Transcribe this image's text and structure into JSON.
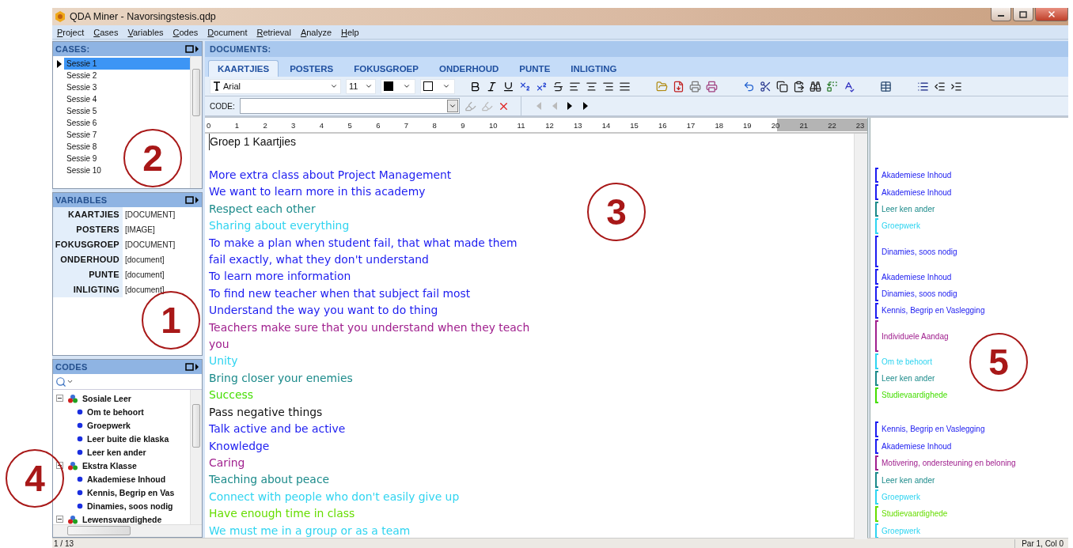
{
  "window": {
    "title": "QDA Miner - Navorsingstesis.qdp"
  },
  "menu": [
    "Project",
    "Cases",
    "Variables",
    "Codes",
    "Document",
    "Retrieval",
    "Analyze",
    "Help"
  ],
  "cases": {
    "title": "CASES:",
    "items": [
      {
        "label": "Sessie 1",
        "selected": true
      },
      {
        "label": "Sessie 2",
        "selected": false
      },
      {
        "label": "Sessie 3",
        "selected": false
      },
      {
        "label": "Sessie 4",
        "selected": false
      },
      {
        "label": "Sessie 5",
        "selected": false
      },
      {
        "label": "Sessie 6",
        "selected": false
      },
      {
        "label": "Sessie 7",
        "selected": false
      },
      {
        "label": "Sessie 8",
        "selected": false
      },
      {
        "label": "Sessie 9",
        "selected": false
      },
      {
        "label": "Sessie 10",
        "selected": false
      }
    ]
  },
  "variables": {
    "title": "VARIABLES",
    "items": [
      {
        "name": "KAARTJIES",
        "type": "[DOCUMENT]"
      },
      {
        "name": "POSTERS",
        "type": "[IMAGE]"
      },
      {
        "name": "FOKUSGROEP",
        "type": "[DOCUMENT]"
      },
      {
        "name": "ONDERHOUD",
        "type": "[document]"
      },
      {
        "name": "PUNTE",
        "type": "[document]"
      },
      {
        "name": "INLIGTING",
        "type": "[document]"
      }
    ]
  },
  "codes": {
    "title": "CODES",
    "tree": [
      {
        "label": "Sosiale Leer",
        "expanded": true,
        "children": [
          {
            "label": "Om te behoort"
          },
          {
            "label": "Groepwerk"
          },
          {
            "label": "Leer buite die klaska"
          },
          {
            "label": "Leer ken ander"
          }
        ]
      },
      {
        "label": "Ekstra Klasse",
        "expanded": true,
        "children": [
          {
            "label": "Akademiese Inhoud"
          },
          {
            "label": "Kennis, Begrip en Vas"
          },
          {
            "label": "Dinamies, soos nodig"
          }
        ]
      },
      {
        "label": "Lewensvaardighede",
        "expanded": true
      }
    ]
  },
  "documents": {
    "title": "DOCUMENTS:",
    "tabs": [
      {
        "label": "KAARTJIES",
        "selected": true
      },
      {
        "label": "POSTERS",
        "selected": false
      },
      {
        "label": "FOKUSGROEP",
        "selected": false
      },
      {
        "label": "ONDERHOUD",
        "selected": false
      },
      {
        "label": "PUNTE",
        "selected": false
      },
      {
        "label": "INLIGTING",
        "selected": false
      }
    ],
    "font": "Arial",
    "font_size": "11",
    "code_label": "CODE:",
    "ruler": [
      "0",
      "1",
      "2",
      "3",
      "4",
      "5",
      "6",
      "7",
      "8",
      "9",
      "10",
      "11",
      "12",
      "13",
      "14",
      "15",
      "16",
      "17",
      "18",
      "19",
      "20",
      "21",
      "22",
      "23"
    ],
    "heading": "Groep 1 Kaartjies",
    "paragraphs": [
      {
        "text": "More extra class about Project Management",
        "color": "#1c1cf0",
        "code": {
          "label": "Akademiese Inhoud",
          "color": "#1c1cf0"
        }
      },
      {
        "text": "We want to learn more in this academy",
        "color": "#1c1cf0",
        "code": {
          "label": "Akademiese Inhoud",
          "color": "#1c1cf0"
        }
      },
      {
        "text": "Respect each other",
        "color": "#1b8a8a",
        "code": {
          "label": "Leer ken ander",
          "color": "#1b8a8a"
        }
      },
      {
        "text": "Sharing about everything",
        "color": "#2fd4f0",
        "code": {
          "label": "Groepwerk",
          "color": "#2fd4f0"
        }
      },
      {
        "text": "To make a plan when student fail, that what made them fail exactly, what they don't understand",
        "color": "#1c1cf0",
        "code": {
          "label": "Dinamies, soos nodig",
          "color": "#1c1cf0"
        }
      },
      {
        "text": "To learn more information",
        "color": "#1c1cf0",
        "code": {
          "label": "Akademiese Inhoud",
          "color": "#1c1cf0"
        }
      },
      {
        "text": "To find new teacher when that subject fail most",
        "color": "#1c1cf0",
        "code": {
          "label": "Dinamies, soos nodig",
          "color": "#1c1cf0"
        }
      },
      {
        "text": "Understand the way you want to do thing",
        "color": "#1c1cf0",
        "code": {
          "label": "Kennis, Begrip en Vaslegging",
          "color": "#1c1cf0"
        }
      },
      {
        "text": "Teachers make sure that you understand when they teach you",
        "color": "#a0208e",
        "code": {
          "label": "Individuele Aandag",
          "color": "#a0208e"
        }
      },
      {
        "text": "Unity",
        "color": "#2fd4f0",
        "code": {
          "label": "Om te behoort",
          "color": "#2fd4f0"
        }
      },
      {
        "text": "Bring closer your enemies",
        "color": "#1b8a8a",
        "code": {
          "label": "Leer ken ander",
          "color": "#1b8a8a"
        }
      },
      {
        "text": "Success",
        "color": "#44dd00",
        "code": {
          "label": "Studievaardighede",
          "color": "#44dd00"
        }
      },
      {
        "text": "Pass negative things",
        "color": "#111111"
      },
      {
        "text": "Talk active and be active",
        "color": "#1c1cf0",
        "code": {
          "label": "Kennis, Begrip en Vaslegging",
          "color": "#1c1cf0"
        }
      },
      {
        "text": "Knowledge",
        "color": "#1c1cf0",
        "code": {
          "label": "Akademiese Inhoud",
          "color": "#1c1cf0"
        }
      },
      {
        "text": "Caring",
        "color": "#a0208e",
        "code": {
          "label": "Motivering, ondersteuning en beloning",
          "color": "#a0208e"
        }
      },
      {
        "text": "Teaching about peace",
        "color": "#1b8a8a",
        "code": {
          "label": "Leer ken ander",
          "color": "#1b8a8a"
        }
      },
      {
        "text": "Connect with people who don't easily give up",
        "color": "#2fd4f0",
        "code": {
          "label": "Groepwerk",
          "color": "#2fd4f0"
        }
      },
      {
        "text": "Have enough time in class",
        "color": "#66dd00",
        "code": {
          "label": "Studievaardighede",
          "color": "#66dd00"
        }
      },
      {
        "text": "We must me in a group or as a team",
        "color": "#2fd4f0",
        "code": {
          "label": "Groepwerk",
          "color": "#2fd4f0"
        }
      }
    ]
  },
  "status_bar": {
    "left": "1 / 13",
    "right": "Par 1, Col 0"
  },
  "annotations": [
    "2",
    "1",
    "3",
    "4",
    "5"
  ]
}
